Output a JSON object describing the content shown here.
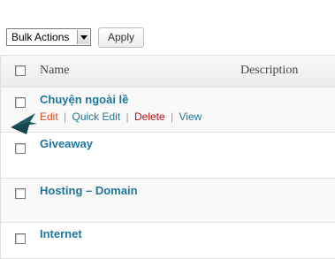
{
  "toolbar": {
    "bulk_actions_selected": "Bulk Actions",
    "apply_label": "Apply"
  },
  "table": {
    "columns": {
      "name": "Name",
      "description": "Description"
    },
    "rows": [
      {
        "title": "Chuyện ngoài lề",
        "actions": {
          "edit": "Edit",
          "quick_edit": "Quick Edit",
          "delete": "Delete",
          "view": "View"
        },
        "separator": "|"
      },
      {
        "title": "Giveaway"
      },
      {
        "title": "Hosting – Domain"
      },
      {
        "title": "Internet"
      }
    ]
  },
  "colors": {
    "link": "#21759b",
    "edit": "#d54e21",
    "delete": "#bc0b0b",
    "pointer_arrow": "#1e5b66"
  },
  "icons": {
    "pointer": "arrow-pointer-icon"
  }
}
